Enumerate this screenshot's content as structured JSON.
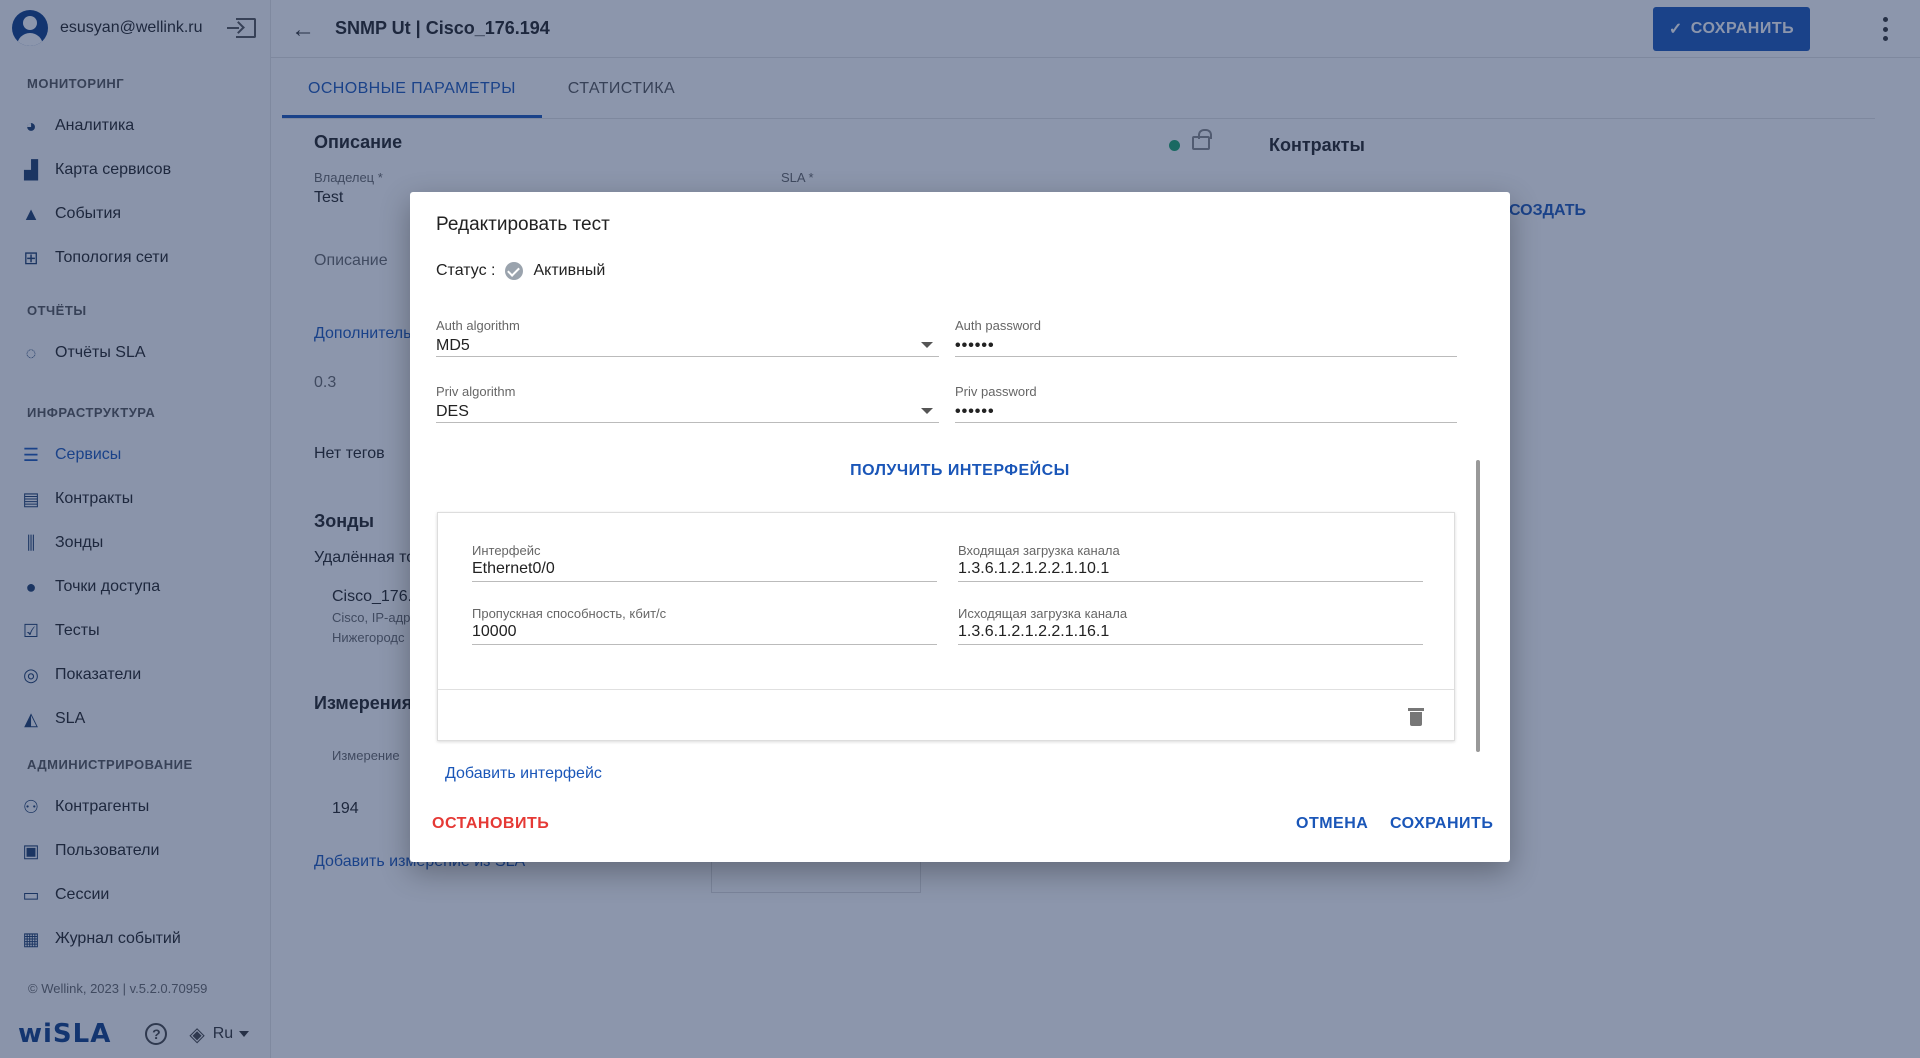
{
  "user": {
    "email": "esusyan@wellink.ru"
  },
  "sidebar": {
    "sections": [
      {
        "title": "МОНИТОРИНГ",
        "items": [
          {
            "label": "Аналитика",
            "icon": "pie-chart-icon"
          },
          {
            "label": "Карта сервисов",
            "icon": "map-icon"
          },
          {
            "label": "События",
            "icon": "warning-icon"
          },
          {
            "label": "Топология сети",
            "icon": "topology-icon"
          }
        ]
      },
      {
        "title": "ОТЧЁТЫ",
        "items": [
          {
            "label": "Отчёты SLA",
            "icon": "report-circle-icon"
          }
        ]
      },
      {
        "title": "ИНФРАСТРУКТУРА",
        "items": [
          {
            "label": "Сервисы",
            "icon": "list-icon",
            "active": true
          },
          {
            "label": "Контракты",
            "icon": "document-icon"
          },
          {
            "label": "Зонды",
            "icon": "probe-icon"
          },
          {
            "label": "Точки доступа",
            "icon": "access-point-icon"
          },
          {
            "label": "Тесты",
            "icon": "test-clipboard-icon"
          },
          {
            "label": "Показатели",
            "icon": "metrics-icon"
          },
          {
            "label": "SLA",
            "icon": "sla-icon"
          }
        ]
      },
      {
        "title": "АДМИНИСТРИРОВАНИЕ",
        "items": [
          {
            "label": "Контрагенты",
            "icon": "people-icon"
          },
          {
            "label": "Пользователи",
            "icon": "user-badge-icon"
          },
          {
            "label": "Сессии",
            "icon": "sessions-icon"
          },
          {
            "label": "Журнал событий",
            "icon": "calendar-log-icon"
          }
        ]
      }
    ],
    "footer": {
      "copyright": "© Wellink, 2023 | v.5.2.0.70959",
      "logo": "wiSLA",
      "language": "Ru"
    }
  },
  "header": {
    "title": "SNMP Ut | Cisco_176.194",
    "save_label": "СОХРАНИТЬ"
  },
  "tabs": [
    {
      "label": "ОСНОВНЫЕ ПАРАМЕТРЫ",
      "active": true
    },
    {
      "label": "СТАТИСТИКА",
      "active": false
    }
  ],
  "background": {
    "description_title": "Описание",
    "owner_label": "Владелец *",
    "owner_value": "Test",
    "sla_label": "SLA *",
    "description_label": "Описание",
    "additional_label": "Дополнитель",
    "value_03": "0.3",
    "no_tags": "Нет тегов",
    "probes_title": "Зонды",
    "remote_label": "Удалённая то",
    "probe_name": "Cisco_176.1",
    "probe_sub1": "Cisco, IP-адр",
    "probe_sub2": "Нижегородс",
    "measurements_title": "Измерения",
    "measurement_col": "Измерение",
    "measurement_val": "194",
    "add_measurement": "Добавить измерение из SLA",
    "contracts_title": "Контракты",
    "create_link": "СОЗДАТЬ"
  },
  "dialog": {
    "title": "Редактировать тест",
    "status_label": "Статус :",
    "status_value": "Активный",
    "auth_algorithm": {
      "label": "Auth algorithm",
      "value": "MD5"
    },
    "auth_password": {
      "label": "Auth password",
      "value": "••••••"
    },
    "priv_algorithm": {
      "label": "Priv algorithm",
      "value": "DES"
    },
    "priv_password": {
      "label": "Priv password",
      "value": "••••••"
    },
    "get_interfaces": "ПОЛУЧИТЬ ИНТЕРФЕЙСЫ",
    "interface": {
      "name_label": "Интерфейс",
      "name_value": "Ethernet0/0",
      "in_label": "Входящая загрузка канала",
      "in_value": "1.3.6.1.2.1.2.2.1.10.1",
      "bw_label": "Пропускная способность, кбит/с",
      "bw_value": "10000",
      "out_label": "Исходящая загрузка канала",
      "out_value": "1.3.6.1.2.1.2.2.1.16.1"
    },
    "add_interface": "Добавить интерфейс",
    "stop_label": "ОСТАНОВИТЬ",
    "cancel_label": "ОТМЕНА",
    "save_label": "СОХРАНИТЬ"
  }
}
